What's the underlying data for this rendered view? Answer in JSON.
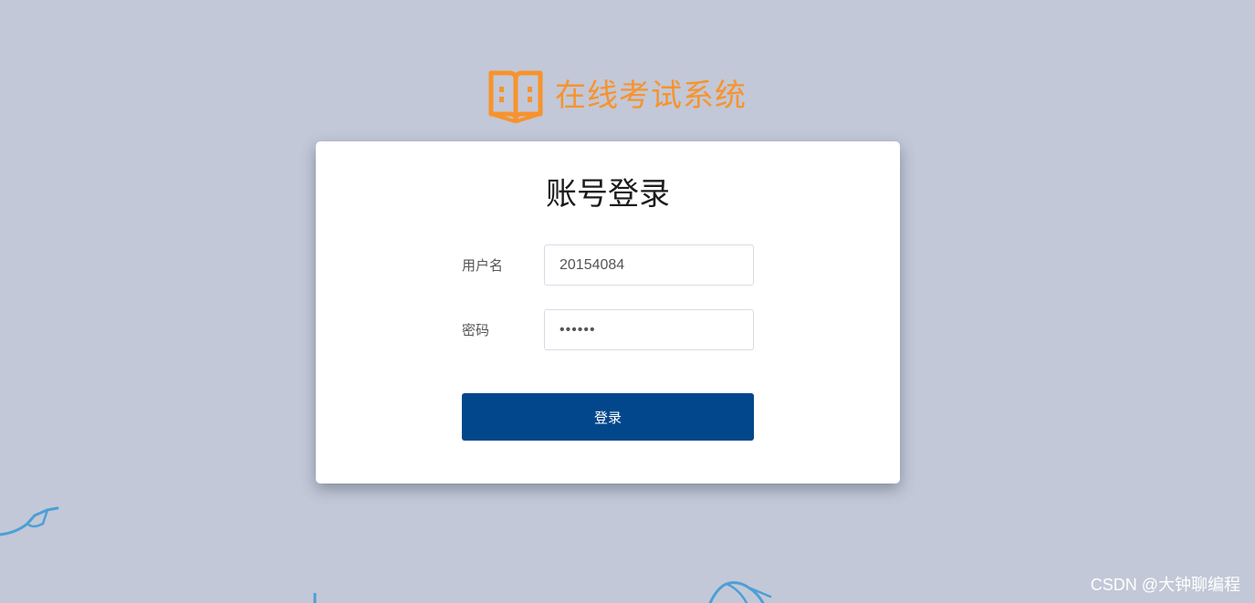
{
  "brand": {
    "title": "在线考试系统",
    "icon": "open-book-icon",
    "color": "#f7932e"
  },
  "login_card": {
    "title": "账号登录",
    "username": {
      "label": "用户名",
      "value": "20154084"
    },
    "password": {
      "label": "密码",
      "value": "••••••"
    },
    "submit_label": "登录"
  },
  "watermark": "CSDN @大钟聊编程",
  "colors": {
    "background": "#c2c8d7",
    "primary_button": "#02478b",
    "doodle": "#4d9fd6"
  }
}
